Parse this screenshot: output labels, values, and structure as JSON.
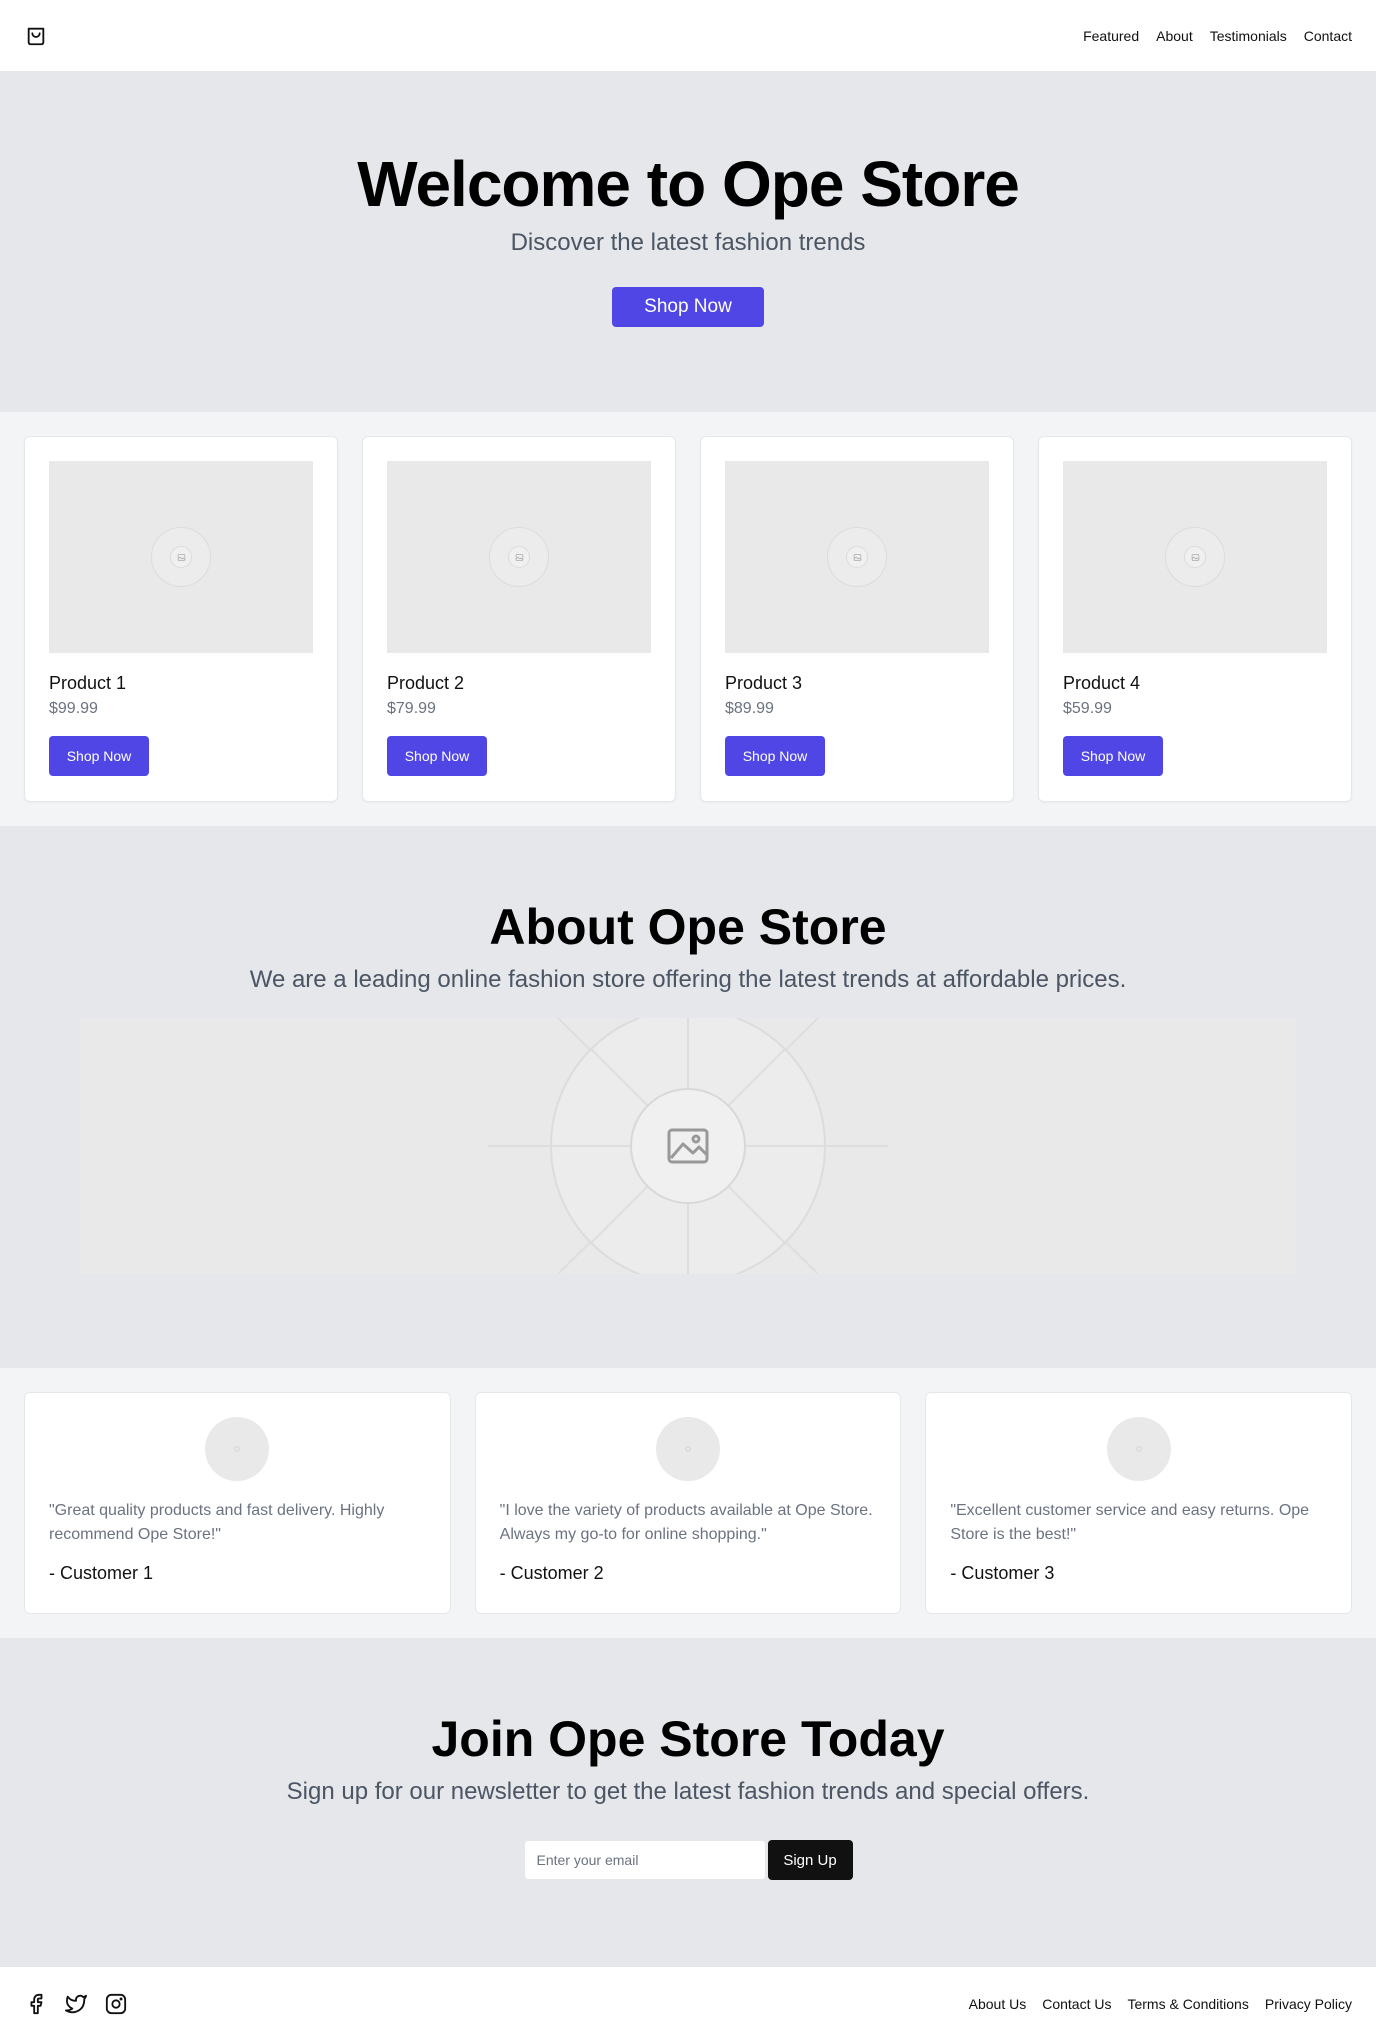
{
  "header": {
    "logo_icon": "shopping-bag-icon",
    "nav": [
      "Featured",
      "About",
      "Testimonials",
      "Contact"
    ]
  },
  "hero": {
    "title": "Welcome to Ope Store",
    "subtitle": "Discover the latest fashion trends",
    "cta_label": "Shop Now"
  },
  "featured": {
    "products": [
      {
        "name": "Product 1",
        "price": "$99.99",
        "button": "Shop Now"
      },
      {
        "name": "Product 2",
        "price": "$79.99",
        "button": "Shop Now"
      },
      {
        "name": "Product 3",
        "price": "$89.99",
        "button": "Shop Now"
      },
      {
        "name": "Product 4",
        "price": "$59.99",
        "button": "Shop Now"
      }
    ]
  },
  "about": {
    "title": "About Ope Store",
    "text": "We are a leading online fashion store offering the latest trends at affordable prices."
  },
  "testimonials": [
    {
      "quote": "\"Great quality products and fast delivery. Highly recommend Ope Store!\"",
      "author": "- Customer 1"
    },
    {
      "quote": "\"I love the variety of products available at Ope Store. Always my go-to for online shopping.\"",
      "author": "- Customer 2"
    },
    {
      "quote": "\"Excellent customer service and easy returns. Ope Store is the best!\"",
      "author": "- Customer 3"
    }
  ],
  "newsletter": {
    "title": "Join Ope Store Today",
    "text": "Sign up for our newsletter to get the latest fashion trends and special offers.",
    "email_placeholder": "Enter your email",
    "button": "Sign Up"
  },
  "footer": {
    "social_icons": [
      "facebook-icon",
      "twitter-icon",
      "instagram-icon"
    ],
    "links": [
      "About Us",
      "Contact Us",
      "Terms & Conditions",
      "Privacy Policy"
    ]
  },
  "colors": {
    "accent": "#4f46e5",
    "section_gray": "#e5e7eb",
    "section_light": "#f3f4f6",
    "dark_button": "#111111"
  }
}
